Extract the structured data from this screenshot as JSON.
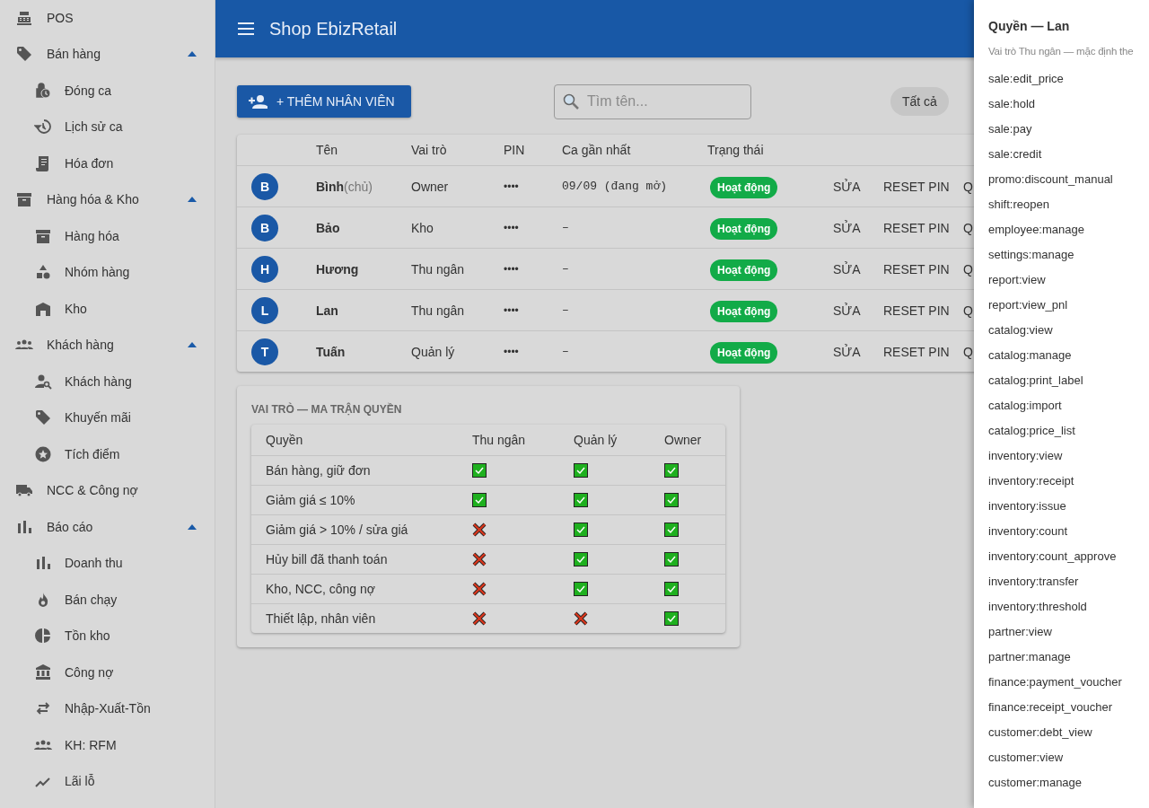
{
  "sidebar": {
    "items": [
      {
        "label": "POS"
      },
      {
        "label": "Bán hàng",
        "expanded": true,
        "children": [
          {
            "label": "Đóng ca"
          },
          {
            "label": "Lịch sử ca"
          },
          {
            "label": "Hóa đơn"
          }
        ]
      },
      {
        "label": "Hàng hóa & Kho",
        "expanded": true,
        "children": [
          {
            "label": "Hàng hóa"
          },
          {
            "label": "Nhóm hàng"
          },
          {
            "label": "Kho"
          }
        ]
      },
      {
        "label": "Khách hàng",
        "expanded": true,
        "children": [
          {
            "label": "Khách hàng"
          },
          {
            "label": "Khuyến mãi"
          },
          {
            "label": "Tích điểm"
          }
        ]
      },
      {
        "label": "NCC & Công nợ"
      },
      {
        "label": "Báo cáo",
        "expanded": true,
        "children": [
          {
            "label": "Doanh thu"
          },
          {
            "label": "Bán chạy"
          },
          {
            "label": "Tồn kho"
          },
          {
            "label": "Công nợ"
          },
          {
            "label": "Nhập-Xuất-Tồn"
          },
          {
            "label": "KH: RFM"
          },
          {
            "label": "Lãi lỗ"
          }
        ]
      }
    ]
  },
  "header": {
    "title": "Shop EbizRetail"
  },
  "toolbar": {
    "add_button": "+ THÊM NHÂN VIÊN",
    "search": {
      "placeholder": "Tìm tên..."
    },
    "filters": [
      {
        "label": "Tất cả"
      }
    ]
  },
  "employees": {
    "columns": [
      "Tên",
      "Vai trò",
      "PIN",
      "Ca gần nhất",
      "Trạng thái"
    ],
    "rows": [
      {
        "avatar": "B",
        "name": "Bình",
        "note": "(chủ)",
        "role": "Owner",
        "pin": "••••",
        "last_shift": "09/09 (đang mở)",
        "status": "Hoạt động",
        "actions": [
          "SỬA",
          "RESET PIN",
          "Q"
        ]
      },
      {
        "avatar": "B",
        "name": "Bảo",
        "role": "Kho",
        "pin": "••••",
        "last_shift": "–",
        "status": "Hoạt động",
        "actions": [
          "SỬA",
          "RESET PIN",
          "Q"
        ]
      },
      {
        "avatar": "H",
        "name": "Hương",
        "role": "Thu ngân",
        "pin": "••••",
        "last_shift": "–",
        "status": "Hoạt động",
        "actions": [
          "SỬA",
          "RESET PIN",
          "Q"
        ]
      },
      {
        "avatar": "L",
        "name": "Lan",
        "role": "Thu ngân",
        "pin": "••••",
        "last_shift": "–",
        "status": "Hoạt động",
        "actions": [
          "SỬA",
          "RESET PIN",
          "Q"
        ]
      },
      {
        "avatar": "T",
        "name": "Tuấn",
        "role": "Quản lý",
        "pin": "••••",
        "last_shift": "–",
        "status": "Hoạt động",
        "actions": [
          "SỬA",
          "RESET PIN",
          "Q"
        ]
      }
    ]
  },
  "matrix": {
    "title": "VAI TRÒ — MA TRẬN QUYỀN",
    "columns": [
      "Quyền",
      "Thu ngân",
      "Quản lý",
      "Owner"
    ],
    "rows": [
      {
        "label": "Bán hàng, giữ đơn",
        "allowed": [
          true,
          true,
          true
        ]
      },
      {
        "label": "Giảm giá ≤ 10%",
        "allowed": [
          true,
          true,
          true
        ]
      },
      {
        "label": "Giảm giá > 10% / sửa giá",
        "allowed": [
          false,
          true,
          true
        ]
      },
      {
        "label": "Hủy bill đã thanh toán",
        "allowed": [
          false,
          true,
          true
        ]
      },
      {
        "label": "Kho, NCC, công nợ",
        "allowed": [
          false,
          true,
          true
        ]
      },
      {
        "label": "Thiết lập, nhân viên",
        "allowed": [
          false,
          false,
          true
        ]
      }
    ]
  },
  "drawer": {
    "title": "Quyền — Lan",
    "subtitle": "Vai trò Thu ngân — mặc định the",
    "permissions": [
      "sale:edit_price",
      "sale:hold",
      "sale:pay",
      "sale:credit",
      "promo:discount_manual",
      "shift:reopen",
      "employee:manage",
      "settings:manage",
      "report:view",
      "report:view_pnl",
      "catalog:view",
      "catalog:manage",
      "catalog:print_label",
      "catalog:import",
      "catalog:price_list",
      "inventory:view",
      "inventory:receipt",
      "inventory:issue",
      "inventory:count",
      "inventory:count_approve",
      "inventory:transfer",
      "inventory:threshold",
      "partner:view",
      "partner:manage",
      "finance:payment_voucher",
      "finance:receipt_voucher",
      "customer:debt_view",
      "customer:view",
      "customer:manage"
    ]
  }
}
